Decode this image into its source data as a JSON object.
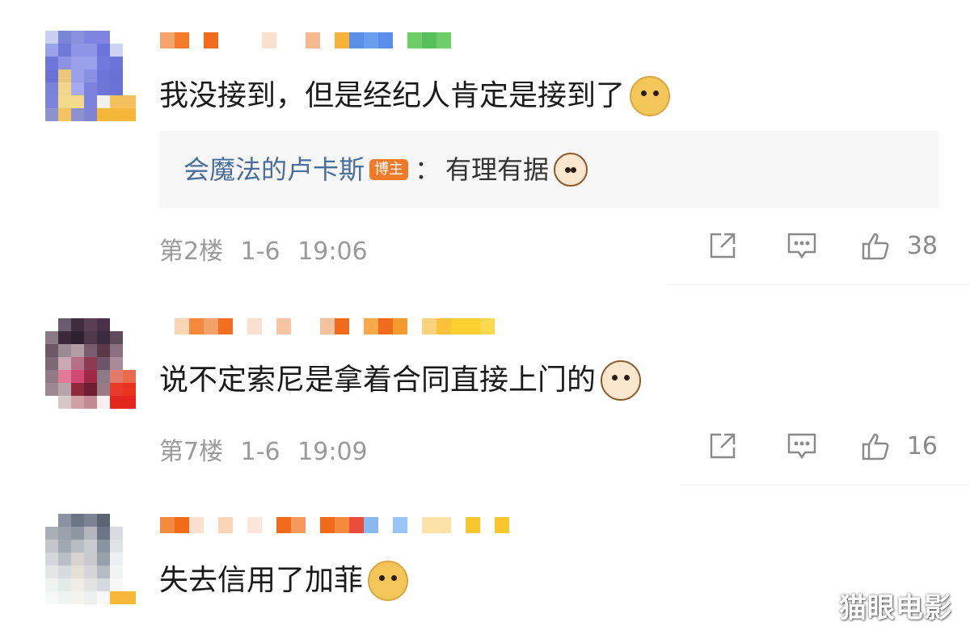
{
  "comments": [
    {
      "text": "我没接到，但是经纪人肯定是接到了",
      "emoji": "doge-emoji",
      "reply": {
        "user": "会魔法的卢卡斯",
        "badge": "博主",
        "sep": "：",
        "text": "有理有据",
        "emoji": "cat-emoji"
      },
      "floor": "第2楼",
      "date": "1-6",
      "time": "19:06",
      "likes": "38"
    },
    {
      "text": "说不定索尼是拿着合同直接上门的",
      "emoji": "cat-emoji",
      "floor": "第7楼",
      "date": "1-6",
      "time": "19:09",
      "likes": "16"
    },
    {
      "text": "失去信用了加菲",
      "emoji": "doge-emoji"
    }
  ],
  "icons": {
    "share": "share-icon",
    "reply": "comment-icon",
    "like": "thumbs-up-icon"
  },
  "colors": {
    "reply_user": "#4a6e9b",
    "badge": "#f07a2a",
    "meta": "#9a9a9a",
    "reply_bg": "#f6f6f6"
  },
  "watermark": "猫眼电影"
}
